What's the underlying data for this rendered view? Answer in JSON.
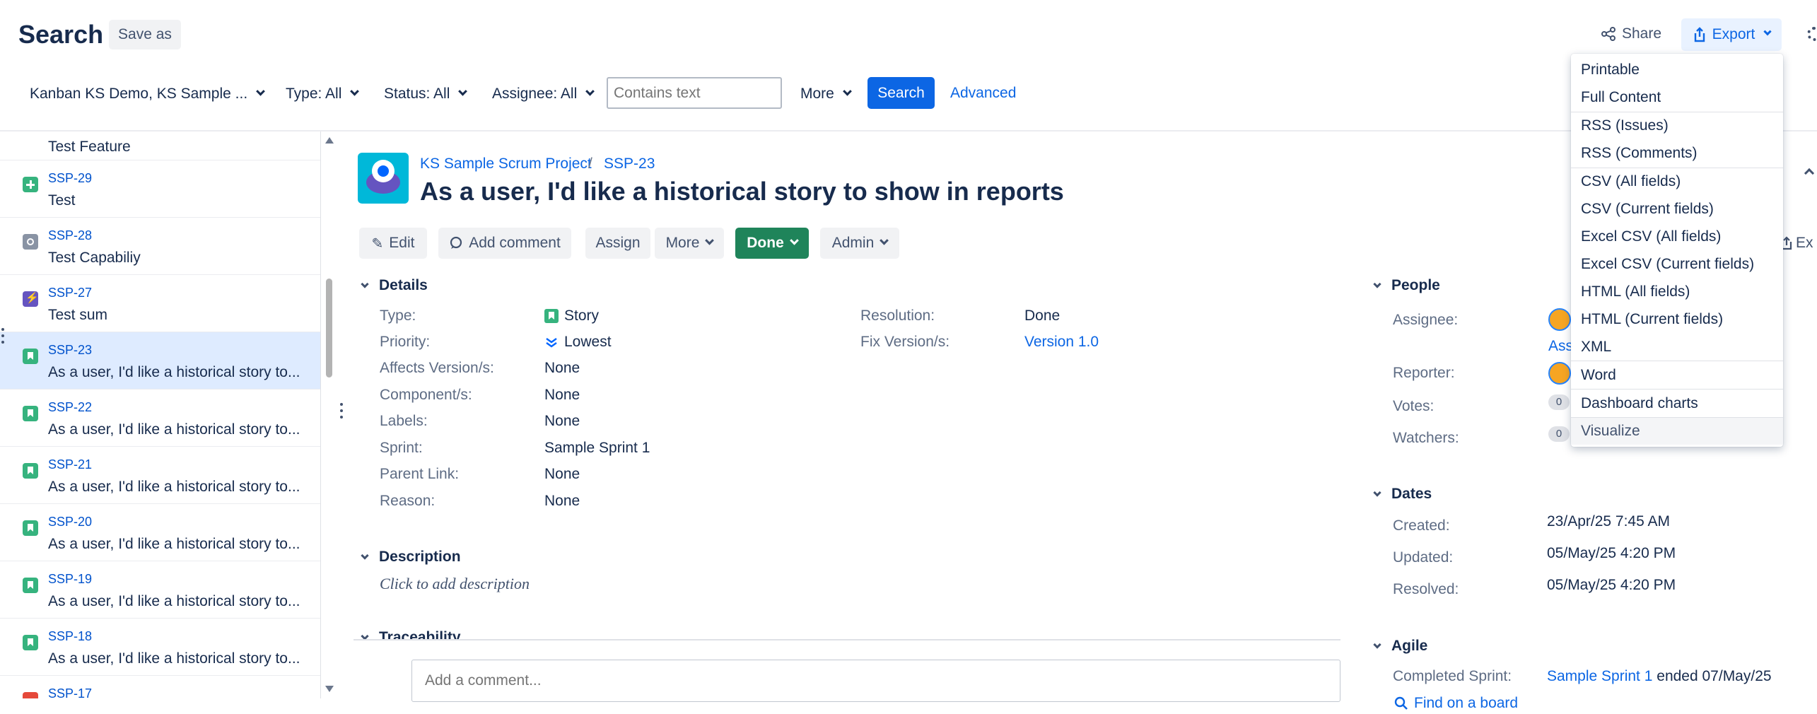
{
  "header": {
    "title": "Search",
    "save_as": "Save as",
    "share": "Share",
    "export": "Export"
  },
  "filters": {
    "project": "Kanban KS Demo, KS Sample ...",
    "type": "Type: All",
    "status": "Status: All",
    "assignee": "Assignee: All",
    "text_placeholder": "Contains text",
    "more": "More",
    "search": "Search",
    "advanced": "Advanced"
  },
  "issue_list": [
    {
      "key": "",
      "summary": "Test Feature",
      "icon": "story-icon"
    },
    {
      "key": "SSP-29",
      "summary": "Test",
      "icon": "plus-icon"
    },
    {
      "key": "SSP-28",
      "summary": "Test Capabiliy",
      "icon": "capability-icon"
    },
    {
      "key": "SSP-27",
      "summary": "Test sum",
      "icon": "epic-icon"
    },
    {
      "key": "SSP-23",
      "summary": "As a user, I'd like a historical story to...",
      "icon": "story-icon",
      "selected": true
    },
    {
      "key": "SSP-22",
      "summary": "As a user, I'd like a historical story to...",
      "icon": "story-icon"
    },
    {
      "key": "SSP-21",
      "summary": "As a user, I'd like a historical story to...",
      "icon": "story-icon"
    },
    {
      "key": "SSP-20",
      "summary": "As a user, I'd like a historical story to...",
      "icon": "story-icon"
    },
    {
      "key": "SSP-19",
      "summary": "As a user, I'd like a historical story to...",
      "icon": "story-icon"
    },
    {
      "key": "SSP-18",
      "summary": "As a user, I'd like a historical story to...",
      "icon": "story-icon"
    },
    {
      "key": "SSP-17",
      "summary": "",
      "icon": "bug-icon"
    }
  ],
  "issue": {
    "project": "KS Sample Scrum Project",
    "key": "SSP-23",
    "title": "As a user, I'd like a historical story to show in reports",
    "actions": {
      "edit": "Edit",
      "comment": "Add comment",
      "assign": "Assign",
      "more": "More",
      "done": "Done",
      "admin": "Admin",
      "export_short": "Ex"
    },
    "details_heading": "Details",
    "fields_left": [
      {
        "label": "Type:",
        "value": "Story"
      },
      {
        "label": "Priority:",
        "value": "Lowest"
      },
      {
        "label": "Affects Version/s:",
        "value": "None"
      },
      {
        "label": "Component/s:",
        "value": "None"
      },
      {
        "label": "Labels:",
        "value": "None"
      },
      {
        "label": "Sprint:",
        "value": "Sample Sprint 1"
      },
      {
        "label": "Parent Link:",
        "value": "None"
      },
      {
        "label": "Reason:",
        "value": "None"
      }
    ],
    "fields_right": [
      {
        "label": "Resolution:",
        "value": "Done"
      },
      {
        "label": "Fix Version/s:",
        "value": "Version 1.0"
      }
    ],
    "description_heading": "Description",
    "description_placeholder": "Click to add description",
    "traceability_heading": "Traceability",
    "comment_placeholder": "Add a comment..."
  },
  "people": {
    "heading": "People",
    "assignee_label": "Assignee:",
    "assign_link": "Assi",
    "reporter_label": "Reporter:",
    "votes_label": "Votes:",
    "votes": "0",
    "watchers_label": "Watchers:",
    "watchers": "0"
  },
  "dates": {
    "heading": "Dates",
    "created_label": "Created:",
    "created": "23/Apr/25 7:45 AM",
    "updated_label": "Updated:",
    "updated": "05/May/25 4:20 PM",
    "resolved_label": "Resolved:",
    "resolved": "05/May/25 4:20 PM"
  },
  "agile": {
    "heading": "Agile",
    "completed_label": "Completed Sprint:",
    "sprint": "Sample Sprint 1",
    "ended": "ended 07/May/25",
    "find": "Find on a board"
  },
  "export_menu": [
    "Printable",
    "Full Content",
    "RSS (Issues)",
    "RSS (Comments)",
    "CSV (All fields)",
    "CSV (Current fields)",
    "Excel CSV (All fields)",
    "Excel CSV (Current fields)",
    "HTML (All fields)",
    "HTML (Current fields)",
    "XML",
    "Word",
    "Dashboard charts",
    "Visualize"
  ],
  "colors": {
    "primary": "#0c66e4",
    "done": "#1f845a",
    "story": "#36b37e",
    "selected_row": "#deebff"
  }
}
